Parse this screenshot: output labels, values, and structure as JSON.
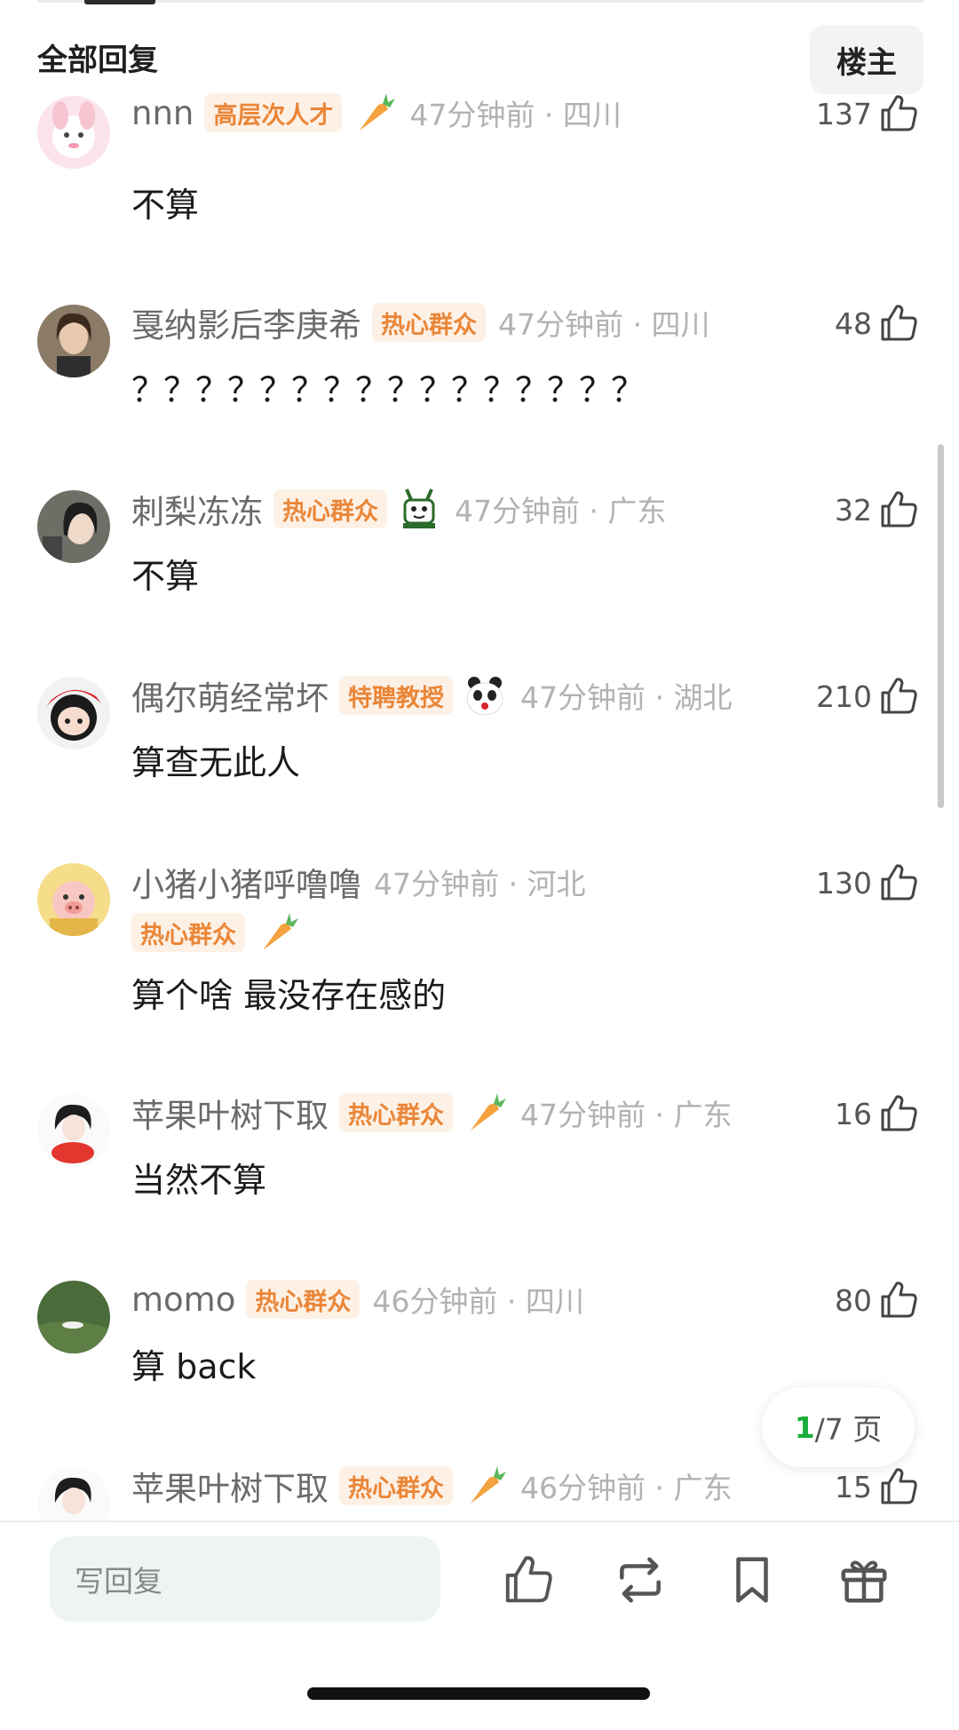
{
  "header": {
    "title": "全部回复",
    "owner_button": "楼主"
  },
  "comments": [
    {
      "name": "nnn",
      "badge": "高层次人才",
      "medal": "carrot-icon",
      "time": "47分钟前 · 四川",
      "likes": "137",
      "text": "不算"
    },
    {
      "name": "戛纳影后李庚希",
      "badge": "热心群众",
      "medal": "",
      "time": "47分钟前 · 四川",
      "likes": "48",
      "text": "？？？？？？？？？？？？？？？？"
    },
    {
      "name": "刺梨冻冻",
      "badge": "热心群众",
      "medal": "rabbit-icon",
      "time": "47分钟前 · 广东",
      "likes": "32",
      "text": "不算"
    },
    {
      "name": "偶尔萌经常坏",
      "badge": "特聘教授",
      "medal": "panda-icon",
      "time": "47分钟前 · 湖北",
      "likes": "210",
      "text": "算查无此人"
    },
    {
      "name": "小猪小猪呼噜噜",
      "badge": "热心群众",
      "medal": "carrot-icon",
      "time": "47分钟前 · 河北",
      "likes": "130",
      "text": "算个啥 最没存在感的"
    },
    {
      "name": "苹果叶树下取",
      "badge": "热心群众",
      "medal": "carrot-icon",
      "time": "47分钟前 · 广东",
      "likes": "16",
      "text": "当然不算"
    },
    {
      "name": "momo",
      "badge": "热心群众",
      "medal": "",
      "time": "46分钟前 · 四川",
      "likes": "80",
      "text": "算 back"
    },
    {
      "name": "苹果叶树下取",
      "badge": "热心群众",
      "medal": "carrot-icon",
      "time": "46分钟前 · 广东",
      "likes": "15",
      "text": ""
    }
  ],
  "pagination": {
    "current": "1",
    "total": "/7 页"
  },
  "bottom_bar": {
    "reply_placeholder": "写回复"
  },
  "colors": {
    "badge_text": "#ea8638",
    "badge_bg": "#fdf1e6",
    "page_current": "#1aad3b"
  }
}
